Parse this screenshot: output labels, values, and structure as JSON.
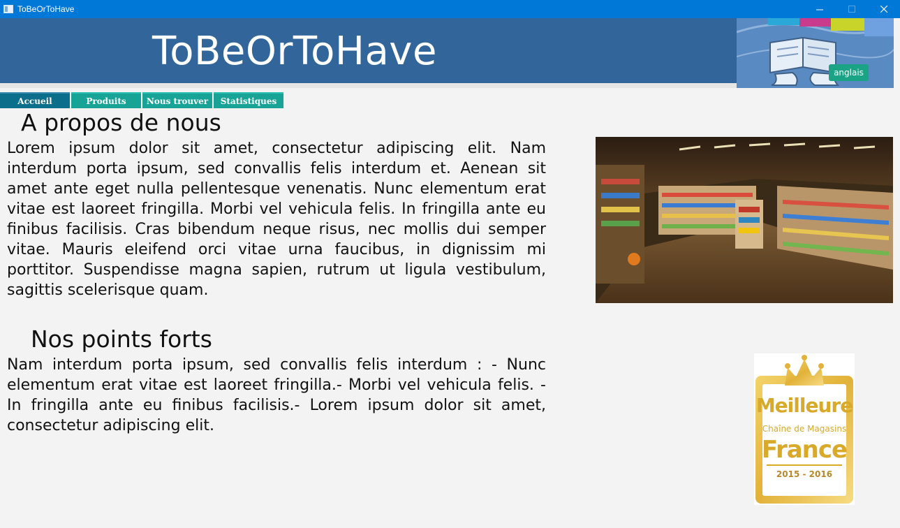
{
  "window": {
    "title": "ToBeOrToHave",
    "minimize_glyph": "—",
    "maximize_glyph": "☐",
    "close_glyph": "✕"
  },
  "header": {
    "title": "ToBeOrToHave",
    "language_button": "anglais",
    "art_icon": "reading-person-illustration"
  },
  "tabs": [
    {
      "label": "Accueil",
      "active": true
    },
    {
      "label": "Produits",
      "active": false
    },
    {
      "label": "Nous trouver",
      "active": false
    },
    {
      "label": "Statistiques",
      "active": false
    }
  ],
  "about": {
    "heading": "A propos de nous",
    "text": "Lorem ipsum dolor sit amet, consectetur adipiscing elit. Nam interdum porta ipsum, sed convallis felis interdum et. Aenean sit amet ante eget nulla pellentesque venenatis. Nunc elementum erat vitae est laoreet fringilla. Morbi vel vehicula felis. In fringilla ante eu finibus facilisis. Cras bibendum neque risus, nec mollis dui semper vitae. Mauris eleifend orci vitae urna faucibus, in dignissim mi porttitor. Suspendisse magna sapien, rutrum ut ligula vestibulum, sagittis scelerisque quam."
  },
  "strengths": {
    "heading": "Nos points forts",
    "text": "Nam interdum porta ipsum, sed convallis felis interdum : - Nunc elementum erat vitae est laoreet fringilla.-  Morbi vel vehicula felis. -  In fringilla ante eu finibus facilisis.-  Lorem ipsum dolor sit amet, consectetur adipiscing elit."
  },
  "award": {
    "line1": "Meilleure",
    "line2": "Chaîne de Magasins",
    "line3": "France",
    "years": "2015 - 2016"
  },
  "colors": {
    "titlebar": "#0078d7",
    "banner": "#326599",
    "tab": "#17a497",
    "tab_active": "#0b6e8b",
    "lang_button": "#1aa384",
    "gold": "#d9a92a"
  }
}
